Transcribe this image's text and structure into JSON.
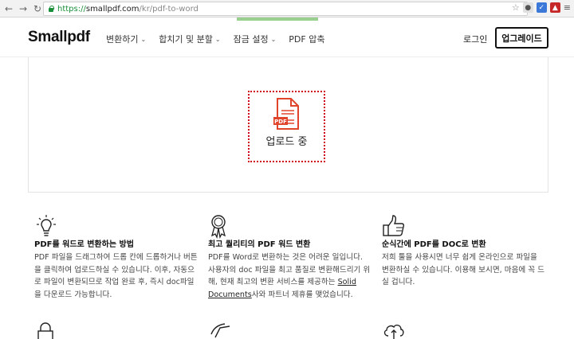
{
  "browser": {
    "url_scheme": "https://",
    "url_host": "smallpdf.com",
    "url_path": "/kr/pdf-to-word",
    "accent_secure": "#1a8f3a"
  },
  "header": {
    "logo": "Smallpdf",
    "nav": [
      {
        "label": "변환하기",
        "has_dropdown": true
      },
      {
        "label": "합치기 및 분할",
        "has_dropdown": true
      },
      {
        "label": "잠금 설정",
        "has_dropdown": true
      },
      {
        "label": "PDF 압축",
        "has_dropdown": false
      }
    ],
    "login": "로그인",
    "upgrade": "업그레이드"
  },
  "upload": {
    "file_badge": "PDF",
    "status": "업로드 중",
    "accent": "#d0011b"
  },
  "features": [
    {
      "icon": "lightbulb-icon",
      "title": "PDF를 워드로 변환하는 방법",
      "body": "PDF 파일을 드래그하여 드롭 칸에 드롭하거나 버튼을 클릭하여 업로드하실 수 있습니다. 이후, 자동으로 파일이 변환되므로 작업 완료 후, 즉시 doc파일을 다운로드 가능합니다."
    },
    {
      "icon": "award-icon",
      "title": "최고 퀄리티의 PDF 워드 변환",
      "body_before": "PDF를 Word로 변환하는 것은 어려운 일입니다. 사용자의 doc 파일을 최고 품질로 변환해드리기 위해, 현재 최고의 변환 서비스를 제공하는 ",
      "link": "Solid Documents",
      "body_after": "사와 파트너 제휴를 맺었습니다."
    },
    {
      "icon": "thumbs-up-icon",
      "title": "순식간에 PDF를 DOC로 변환",
      "body": "저희 툴을 사용시면 너무 쉽게 온라인으로 파일을 변환하실 수 있습니다. 이용해 보시면, 마음에 꼭 드실 겁니다."
    }
  ]
}
